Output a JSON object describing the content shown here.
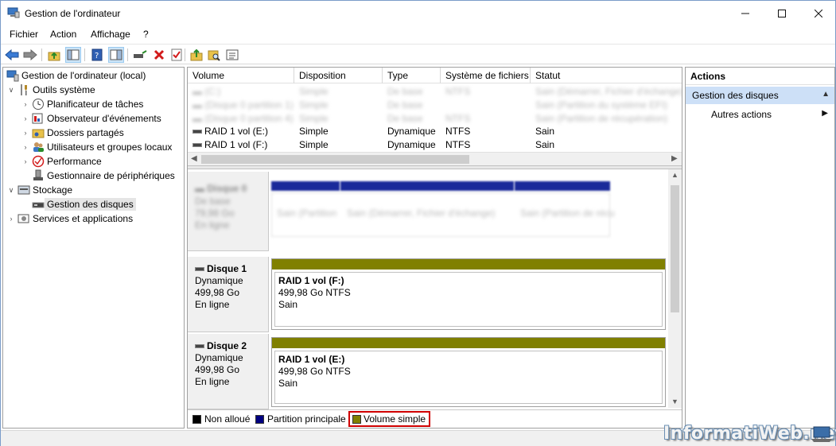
{
  "window": {
    "title": "Gestion de l'ordinateur"
  },
  "menu": {
    "items": [
      "Fichier",
      "Action",
      "Affichage",
      "?"
    ]
  },
  "tree": {
    "root": "Gestion de l'ordinateur (local)",
    "outils": "Outils système",
    "planificateur": "Planificateur de tâches",
    "observateur": "Observateur d'événements",
    "dossiers": "Dossiers partagés",
    "utilisateurs": "Utilisateurs et groupes locaux",
    "performance": "Performance",
    "peripheriques": "Gestionnaire de périphériques",
    "stockage": "Stockage",
    "disques": "Gestion des disques",
    "services": "Services et applications"
  },
  "volume_table": {
    "headers": [
      "Volume",
      "Disposition",
      "Type",
      "Système de fichiers",
      "Statut"
    ],
    "rows": [
      [
        "RAID 1 vol (E:)",
        "Simple",
        "Dynamique",
        "NTFS",
        "Sain"
      ],
      [
        "RAID 1 vol (F:)",
        "Simple",
        "Dynamique",
        "NTFS",
        "Sain"
      ]
    ]
  },
  "disks": [
    {
      "name": "Disque 1",
      "type": "Dynamique",
      "size": "499,98 Go",
      "state": "En ligne",
      "volume": {
        "name": "RAID 1 vol  (F:)",
        "info": "499,98 Go NTFS",
        "status": "Sain"
      }
    },
    {
      "name": "Disque 2",
      "type": "Dynamique",
      "size": "499,98 Go",
      "state": "En ligne",
      "volume": {
        "name": "RAID 1 vol  (E:)",
        "info": "499,98 Go NTFS",
        "status": "Sain"
      }
    }
  ],
  "legend": {
    "items": [
      {
        "label": "Non alloué",
        "color": "#000000"
      },
      {
        "label": "Partition principale",
        "color": "#000080"
      },
      {
        "label": "Volume simple",
        "color": "#808000"
      }
    ]
  },
  "actions": {
    "title": "Actions",
    "selected": "Gestion des disques",
    "sub": "Autres actions"
  },
  "watermark": "InformatiWeb.net",
  "colors": {
    "selection": "#cde0f7",
    "simple_volume": "#808000",
    "primary_partition": "#000080",
    "highlight": "#d00000"
  }
}
